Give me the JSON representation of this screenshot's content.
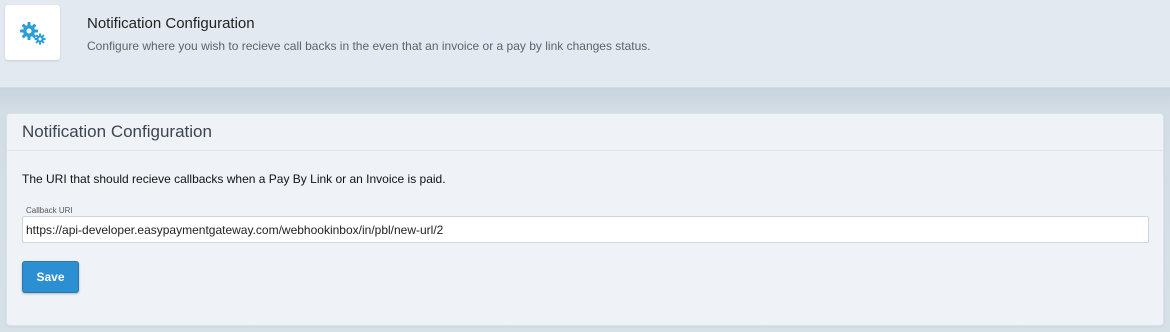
{
  "header": {
    "icon": "gears-icon",
    "title": "Notification Configuration",
    "subtitle": "Configure where you wish to recieve call backs in the even that an invoice or a pay by link changes status."
  },
  "panel": {
    "title": "Notification Configuration",
    "description": "The URI that should recieve callbacks when a Pay By Link or an Invoice is paid.",
    "callback_field": {
      "label": "Callback URI",
      "value": "https://api-developer.easypaymentgateway.com/webhookinbox/in/pbl/new-url/2"
    },
    "save_label": "Save"
  },
  "colors": {
    "accent": "#2c8fd1",
    "icon": "#2a9ed6"
  }
}
